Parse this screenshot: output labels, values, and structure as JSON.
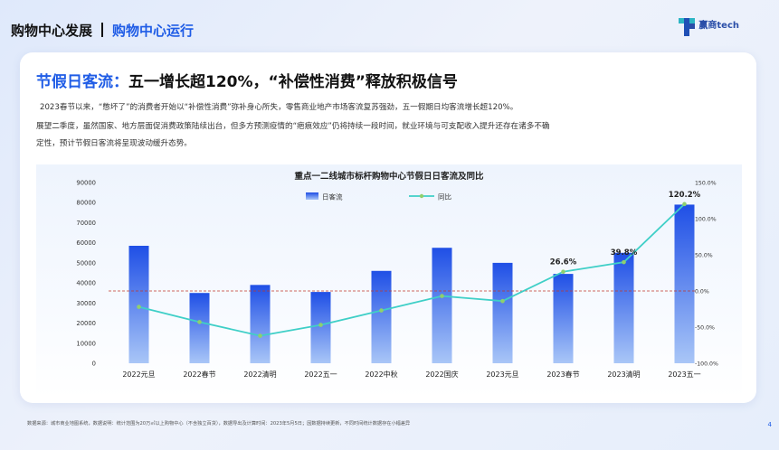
{
  "header": {
    "section": "购物中心发展",
    "subsection": "购物中心运行"
  },
  "logo": {
    "name": "赢商tech"
  },
  "slide": {
    "title_accent": "节假日客流：",
    "title_rest": "五一增长超120%，“补偿性消费”释放积极信号",
    "para1": "2023春节以来，“憋坏了”的消费者开始以“补偿性消费”弥补身心所失，零售商业地产市场客流复苏强劲，五一假期日均客流增长超120%。",
    "para2_line1": "展望二季度，虽然国家、地方层面促消费政策陆续出台，但多方预测疫情的“疤痕效应”仍将持续一段时间，就业环境与可支配收入提升还存在诸多不确",
    "para2_line2": "定性，预计节假日客流将呈现波动缓升态势。"
  },
  "chart_data": {
    "type": "bar",
    "title": "重点一二线城市标杆购物中心节假日日客流及同比",
    "categories": [
      "2022元旦",
      "2022春节",
      "2022清明",
      "2022五一",
      "2022中秋",
      "2022国庆",
      "2023元旦",
      "2023春节",
      "2023清明",
      "2023五一"
    ],
    "series": [
      {
        "name": "日客流",
        "type": "bar",
        "axis": "left",
        "color": "#2255e8",
        "values": [
          58500,
          35000,
          39000,
          35500,
          46000,
          57500,
          50000,
          44500,
          55000,
          79000
        ]
      },
      {
        "name": "同比",
        "type": "line",
        "axis": "right",
        "color": "#3fcfc7",
        "values": [
          -22,
          -43,
          -62,
          -47,
          -27,
          -7,
          -14,
          26.6,
          39.8,
          120.2
        ]
      }
    ],
    "left_axis": {
      "ylim": [
        0,
        90000
      ],
      "ticks": [
        "0",
        "10000",
        "20000",
        "30000",
        "40000",
        "50000",
        "60000",
        "70000",
        "80000",
        "90000"
      ]
    },
    "right_axis": {
      "ylim": [
        -100,
        150
      ],
      "ticks": [
        "-100.0%",
        "-50.0%",
        "0.0%",
        "50.0%",
        "100.0%",
        "150.0%"
      ]
    },
    "point_labels": [
      {
        "index": 7,
        "text": "26.6%"
      },
      {
        "index": 8,
        "text": "39.8%"
      },
      {
        "index": 9,
        "text": "120.2%"
      }
    ],
    "reference_line": {
      "axis": "right",
      "value": 0,
      "color": "#c0392b",
      "style": "dashed"
    },
    "legend_position": "top-center",
    "grid": false
  },
  "footnote": "数据来源：城市商业地图系统，数据说明：统计范围为20万㎡以上购物中心（不含独立百货），数据导出及计算时间：2023年5月5日；因数据持续更新，不同时间统计数据存在小幅差异",
  "page_number": "4"
}
